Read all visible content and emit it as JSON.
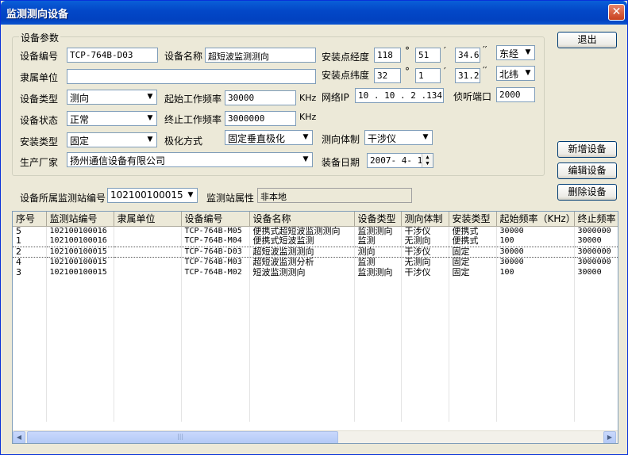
{
  "window": {
    "title": "监测测向设备",
    "close_glyph": "✕"
  },
  "buttons": {
    "exit": "退出",
    "add": "新增设备",
    "edit": "编辑设备",
    "delete": "删除设备"
  },
  "group": {
    "title": "设备参数",
    "labels": {
      "device_no": "设备编号",
      "device_name": "设备名称",
      "owner": "隶属单位",
      "device_type": "设备类型",
      "device_state": "设备状态",
      "install_type": "安装类型",
      "manufacturer": "生产厂家",
      "start_freq": "起始工作频率",
      "end_freq": "终止工作频率",
      "polarization": "极化方式",
      "df_system": "测向体制",
      "lon": "安装点经度",
      "lat": "安装点纬度",
      "ip": "网络IP",
      "port": "侦听端口",
      "install_date": "装备日期",
      "khz1": "KHz",
      "khz2": "KHz"
    },
    "values": {
      "device_no": "TCP-764B-D03",
      "device_name": "超短波监测测向",
      "owner": "",
      "device_type": "测向",
      "device_state": "正常",
      "install_type": "固定",
      "manufacturer": "扬州通信设备有限公司",
      "start_freq": "30000",
      "end_freq": "3000000",
      "polarization": "固定垂直极化",
      "df_system": "干涉仪",
      "lon_deg": "118",
      "lon_min": "51",
      "lon_sec": "34.6",
      "lon_dir": "东经",
      "lat_deg": "32",
      "lat_min": "1",
      "lat_sec": "31.2",
      "lat_dir": "北纬",
      "ip": "10 . 10 . 2 .134",
      "port": "2000",
      "install_date": "2007- 4- 1"
    },
    "marks": {
      "deg": "°",
      "min": "′",
      "sec": "′′"
    }
  },
  "station": {
    "no_label": "设备所属监测站编号",
    "no_value": "102100100015",
    "attr_label": "监测站属性",
    "attr_value": "非本地"
  },
  "table": {
    "columns": [
      "序号",
      "监测站编号",
      "隶属单位",
      "设备编号",
      "设备名称",
      "设备类型",
      "测向体制",
      "安装类型",
      "起始频率（KHz）",
      "终止频率"
    ],
    "rows": [
      [
        "5",
        "102100100016",
        "",
        "TCP-764B-M05",
        "便携式超短波监测测向",
        "监测测向",
        "干涉仪",
        "便携式",
        "30000",
        "3000000"
      ],
      [
        "1",
        "102100100016",
        "",
        "TCP-764B-M04",
        "便携式短波监测",
        "监测",
        "无测向",
        "便携式",
        "100",
        "30000"
      ],
      [
        "2",
        "102100100015",
        "",
        "TCP-764B-D03",
        "超短波监测测向",
        "测向",
        "干涉仪",
        "固定",
        "30000",
        "3000000"
      ],
      [
        "4",
        "102100100015",
        "",
        "TCP-764B-M03",
        "超短波监测分析",
        "监测",
        "无测向",
        "固定",
        "30000",
        "3000000"
      ],
      [
        "3",
        "102100100015",
        "",
        "TCP-764B-M02",
        "短波监测测向",
        "监测测向",
        "干涉仪",
        "固定",
        "100",
        "30000"
      ]
    ],
    "selected_row_index": 2,
    "scroll_glyphs": {
      "left": "◀",
      "right": "▶",
      "grip": "|||"
    }
  }
}
